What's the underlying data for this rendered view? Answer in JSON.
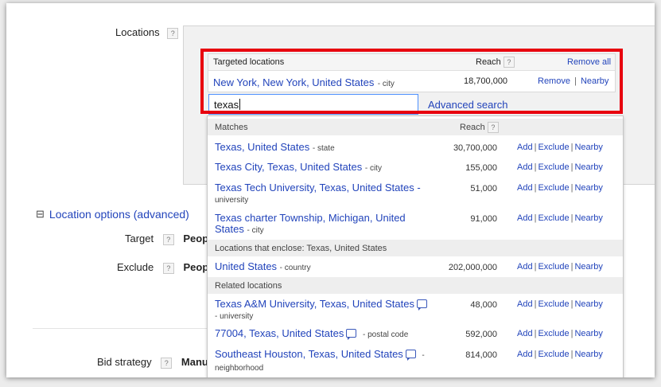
{
  "form": {
    "locations_label": "Locations",
    "help_mark": "?",
    "location_options": {
      "collapse_glyph": "⊟",
      "label": "Location options (advanced)"
    },
    "target": {
      "label": "Target",
      "value": "Peop"
    },
    "exclude": {
      "label": "Exclude",
      "value": "Peop"
    },
    "bid_strategy": {
      "label": "Bid strategy",
      "value": "Manu"
    }
  },
  "targeted": {
    "header": {
      "title": "Targeted locations",
      "reach": "Reach",
      "remove_all": "Remove all"
    },
    "items": [
      {
        "name": "New York, New York, United States",
        "type": "- city",
        "reach": "18,700,000",
        "remove": "Remove",
        "sep": "|",
        "nearby": "Nearby"
      }
    ]
  },
  "search": {
    "value": "texas",
    "advanced_link": "Advanced search"
  },
  "dropdown": {
    "matches_header": {
      "title": "Matches",
      "reach": "Reach"
    },
    "actions": {
      "add": "Add",
      "exclude": "Exclude",
      "nearby": "Nearby",
      "sep": "|"
    },
    "matches": [
      {
        "name": "Texas, United States",
        "type": "- state",
        "reach": "30,700,000"
      },
      {
        "name": "Texas City, Texas, United States",
        "type": "- city",
        "reach": "155,000"
      },
      {
        "name": "Texas Tech University, Texas, United States -",
        "type": "university",
        "reach": "51,000"
      },
      {
        "name": "Texas charter Township, Michigan, United States",
        "type": "- city",
        "reach": "91,000"
      }
    ],
    "enclose_header": "Locations that enclose: Texas, United States",
    "enclose": [
      {
        "name": "United States",
        "type": "- country",
        "reach": "202,000,000"
      }
    ],
    "related_header": "Related locations",
    "related": [
      {
        "name": "Texas A&M University, Texas, United States",
        "type": "- university",
        "reach": "48,000"
      },
      {
        "name": "77004, Texas, United States",
        "type": "- postal code",
        "reach": "592,000"
      },
      {
        "name": "Southeast Houston, Texas, United States",
        "type": "neighborhood",
        "reach": "814,000"
      }
    ],
    "related_dash": "-"
  }
}
